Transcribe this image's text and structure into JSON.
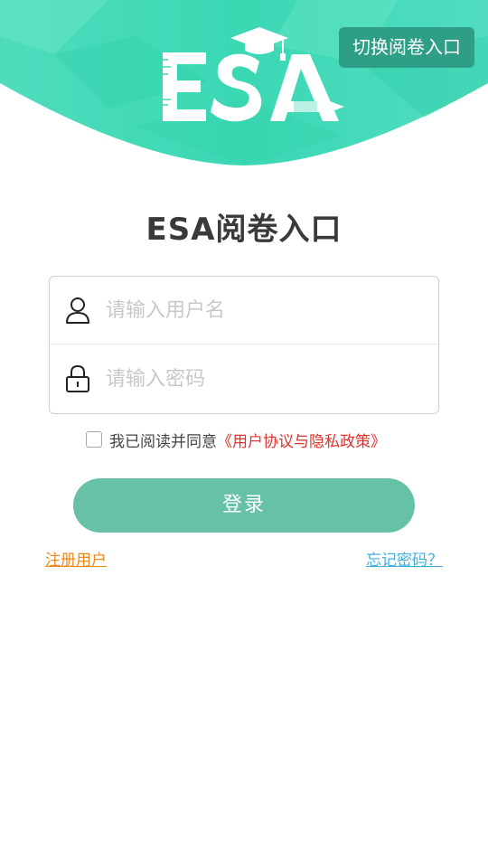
{
  "header": {
    "logo_text": "ESA",
    "switch_label": "切换阅卷入口"
  },
  "title": "ESA阅卷入口",
  "form": {
    "username_placeholder": "请输入用户名",
    "password_placeholder": "请输入密码"
  },
  "agreement": {
    "prefix": "我已阅读并同意",
    "link": "《用户协议与隐私政策》",
    "checked": false
  },
  "login_label": "登录",
  "links": {
    "register": "注册用户",
    "forgot": "忘记密码？"
  },
  "colors": {
    "header_light": "#5ee0be",
    "header_mid": "#37d6b2",
    "switch_bg": "#2f9e86",
    "login_bg": "#66c1a6",
    "agreement_link": "#e0322e",
    "register_link": "#ef8a1a",
    "forgot_link": "#3fb0e0"
  }
}
